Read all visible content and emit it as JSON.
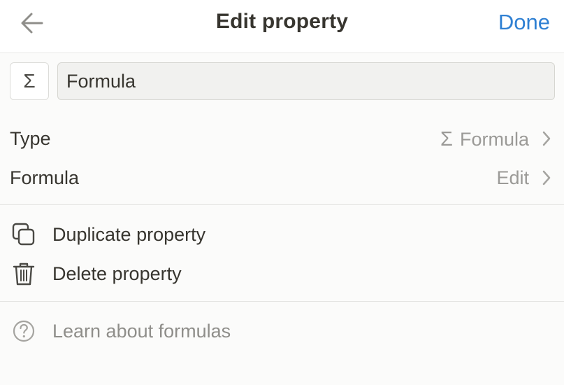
{
  "header": {
    "title": "Edit property",
    "done_label": "Done",
    "back_icon": "arrow-left-icon"
  },
  "property": {
    "icon_glyph": "Σ",
    "name_value": "Formula"
  },
  "settings": {
    "type_label": "Type",
    "type_value_icon": "Σ",
    "type_value": "Formula",
    "formula_label": "Formula",
    "formula_value": "Edit"
  },
  "actions": {
    "duplicate_label": "Duplicate property",
    "delete_label": "Delete property"
  },
  "help": {
    "learn_label": "Learn about formulas"
  },
  "colors": {
    "accent": "#2f80d3",
    "text": "#37352f",
    "muted": "#9b9a97",
    "background": "#fbfbfa"
  }
}
